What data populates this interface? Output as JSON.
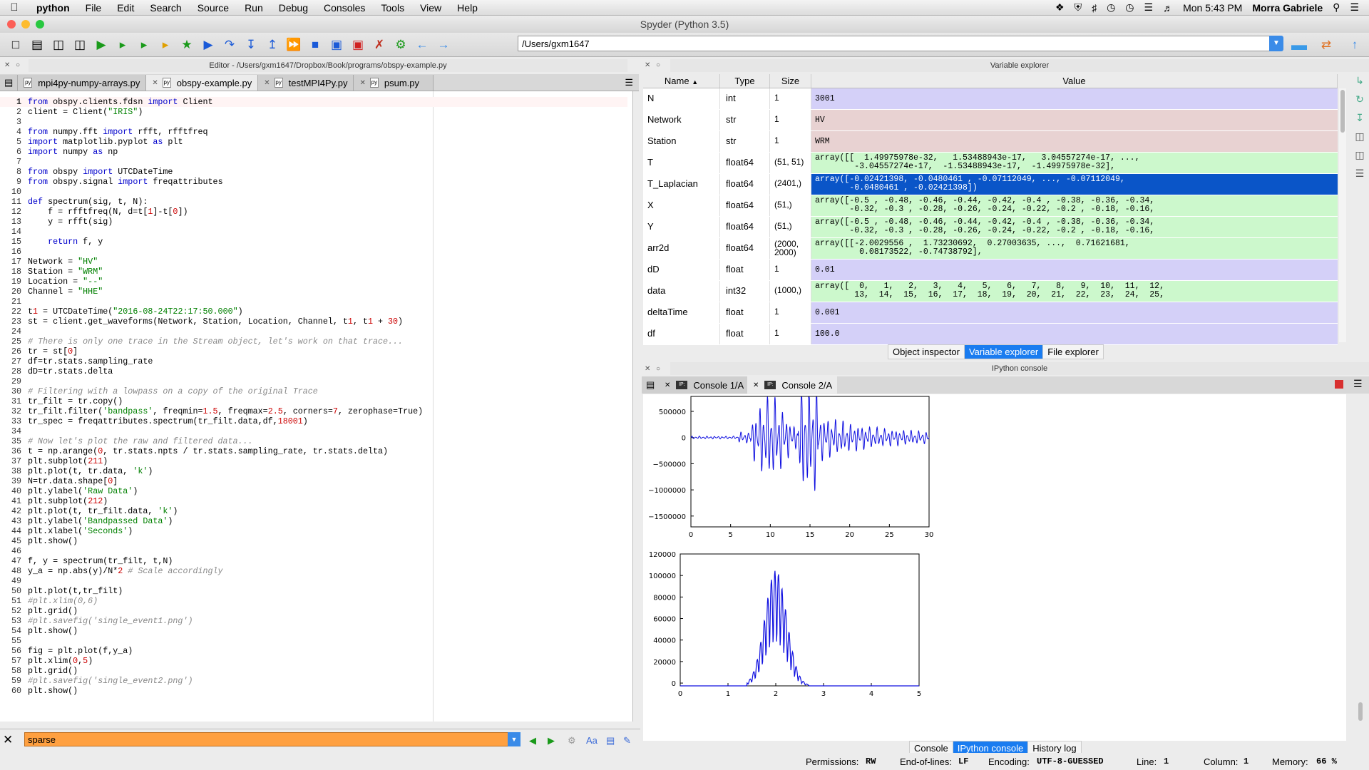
{
  "menubar": {
    "app": "python",
    "items": [
      "File",
      "Edit",
      "Search",
      "Source",
      "Run",
      "Debug",
      "Consoles",
      "Tools",
      "View",
      "Help"
    ],
    "clock": "Mon 5:43 PM",
    "user": "Morra Gabriele"
  },
  "window": {
    "title": "Spyder (Python 3.5)"
  },
  "toolbar": {
    "path": "/Users/gxm1647"
  },
  "editor": {
    "title": "Editor - /Users/gxm1647/Dropbox/Book/programs/obspy-example.py",
    "tabs": [
      "mpi4py-numpy-arrays.py",
      "obspy-example.py",
      "testMPI4Py.py",
      "psum.py"
    ],
    "active_tab": 1,
    "lines": [
      {
        "n": "1",
        "t": "from obspy.clients.fdsn import Client"
      },
      {
        "n": "2",
        "t": "client = Client(\"IRIS\")"
      },
      {
        "n": "3",
        "t": ""
      },
      {
        "n": "4",
        "t": "from numpy.fft import rfft, rfftfreq"
      },
      {
        "n": "5",
        "t": "import matplotlib.pyplot as plt"
      },
      {
        "n": "6",
        "t": "import numpy as np"
      },
      {
        "n": "7",
        "t": ""
      },
      {
        "n": "8",
        "t": "from obspy import UTCDateTime"
      },
      {
        "n": "9",
        "t": "from obspy.signal import freqattributes"
      },
      {
        "n": "10",
        "t": ""
      },
      {
        "n": "11",
        "t": "def spectrum(sig, t, N):"
      },
      {
        "n": "12",
        "t": "    f = rfftfreq(N, d=t[1]-t[0])"
      },
      {
        "n": "13",
        "t": "    y = rfft(sig)"
      },
      {
        "n": "14",
        "t": ""
      },
      {
        "n": "15",
        "t": "    return f, y"
      },
      {
        "n": "16",
        "t": ""
      },
      {
        "n": "17",
        "t": "Network = \"HV\""
      },
      {
        "n": "18",
        "t": "Station = \"WRM\""
      },
      {
        "n": "19",
        "t": "Location = \"--\""
      },
      {
        "n": "20",
        "t": "Channel = \"HHE\""
      },
      {
        "n": "21",
        "t": ""
      },
      {
        "n": "22",
        "t": "t1 = UTCDateTime(\"2016-08-24T22:17:50.000\")"
      },
      {
        "n": "23",
        "t": "st = client.get_waveforms(Network, Station, Location, Channel, t1, t1 + 30)"
      },
      {
        "n": "24",
        "t": ""
      },
      {
        "n": "25",
        "t": "# There is only one trace in the Stream object, let's work on that trace..."
      },
      {
        "n": "26",
        "t": "tr = st[0]"
      },
      {
        "n": "27",
        "t": "df=tr.stats.sampling_rate"
      },
      {
        "n": "28",
        "t": "dD=tr.stats.delta"
      },
      {
        "n": "29",
        "t": ""
      },
      {
        "n": "30",
        "t": "# Filtering with a lowpass on a copy of the original Trace"
      },
      {
        "n": "31",
        "t": "tr_filt = tr.copy()"
      },
      {
        "n": "32",
        "t": "tr_filt.filter('bandpass', freqmin=1.5, freqmax=2.5, corners=7, zerophase=True)"
      },
      {
        "n": "33",
        "t": "tr_spec = freqattributes.spectrum(tr_filt.data,df,18001)"
      },
      {
        "n": "34",
        "t": ""
      },
      {
        "n": "35",
        "t": "# Now let's plot the raw and filtered data..."
      },
      {
        "n": "36",
        "t": "t = np.arange(0, tr.stats.npts / tr.stats.sampling_rate, tr.stats.delta)"
      },
      {
        "n": "37",
        "t": "plt.subplot(211)"
      },
      {
        "n": "38",
        "t": "plt.plot(t, tr.data, 'k')"
      },
      {
        "n": "39",
        "t": "N=tr.data.shape[0]"
      },
      {
        "n": "40",
        "t": "plt.ylabel('Raw Data')"
      },
      {
        "n": "41",
        "t": "plt.subplot(212)"
      },
      {
        "n": "42",
        "t": "plt.plot(t, tr_filt.data, 'k')"
      },
      {
        "n": "43",
        "t": "plt.ylabel('Bandpassed Data')"
      },
      {
        "n": "44",
        "t": "plt.xlabel('Seconds')"
      },
      {
        "n": "45",
        "t": "plt.show()"
      },
      {
        "n": "46",
        "t": ""
      },
      {
        "n": "47",
        "t": "f, y = spectrum(tr_filt, t,N)"
      },
      {
        "n": "48",
        "t": "y_a = np.abs(y)/N*2 # Scale accordingly"
      },
      {
        "n": "49",
        "t": ""
      },
      {
        "n": "50",
        "t": "plt.plot(t,tr_filt)"
      },
      {
        "n": "51",
        "t": "#plt.xlim(0,6)"
      },
      {
        "n": "52",
        "t": "plt.grid()"
      },
      {
        "n": "53",
        "t": "#plt.savefig('single_event1.png')"
      },
      {
        "n": "54",
        "t": "plt.show()"
      },
      {
        "n": "55",
        "t": ""
      },
      {
        "n": "56",
        "t": "fig = plt.plot(f,y_a)"
      },
      {
        "n": "57",
        "t": "plt.xlim(0,5)"
      },
      {
        "n": "58",
        "t": "plt.grid()"
      },
      {
        "n": "59",
        "t": "#plt.savefig('single_event2.png')"
      },
      {
        "n": "60",
        "t": "plt.show()"
      }
    ]
  },
  "find": {
    "value": "sparse"
  },
  "varexp": {
    "title": "Variable explorer",
    "headers": [
      "Name",
      "Type",
      "Size",
      "Value"
    ],
    "rows": [
      {
        "name": "N",
        "type": "int",
        "size": "1",
        "value": "3001",
        "color": "#d4d0f8"
      },
      {
        "name": "Network",
        "type": "str",
        "size": "1",
        "value": "HV",
        "color": "#e8d2d2"
      },
      {
        "name": "Station",
        "type": "str",
        "size": "1",
        "value": "WRM",
        "color": "#e8d2d2"
      },
      {
        "name": "T",
        "type": "float64",
        "size": "(51, 51)",
        "value": "array([[  1.49975978e-32,   1.53488943e-17,   3.04557274e-17, ...,\n        -3.04557274e-17,  -1.53488943e-17,  -1.49975978e-32],",
        "color": "#ccf8cc"
      },
      {
        "name": "T_Laplacian",
        "type": "float64",
        "size": "(2401,)",
        "value": "array([-0.02421398, -0.0480461 , -0.07112049, ..., -0.07112049,\n       -0.0480461 , -0.02421398])",
        "color": "#0a55c8",
        "selected": true
      },
      {
        "name": "X",
        "type": "float64",
        "size": "(51,)",
        "value": "array([-0.5 , -0.48, -0.46, -0.44, -0.42, -0.4 , -0.38, -0.36, -0.34,\n       -0.32, -0.3 , -0.28, -0.26, -0.24, -0.22, -0.2 , -0.18, -0.16,",
        "color": "#ccf8cc"
      },
      {
        "name": "Y",
        "type": "float64",
        "size": "(51,)",
        "value": "array([-0.5 , -0.48, -0.46, -0.44, -0.42, -0.4 , -0.38, -0.36, -0.34,\n       -0.32, -0.3 , -0.28, -0.26, -0.24, -0.22, -0.2 , -0.18, -0.16,",
        "color": "#ccf8cc"
      },
      {
        "name": "arr2d",
        "type": "float64",
        "size": "(2000,\n2000)",
        "value": "array([[-2.0029556 ,  1.73230692,  0.27003635, ...,  0.71621681,\n         0.08173522, -0.74738792],",
        "color": "#ccf8cc"
      },
      {
        "name": "dD",
        "type": "float",
        "size": "1",
        "value": "0.01",
        "color": "#d4d0f8"
      },
      {
        "name": "data",
        "type": "int32",
        "size": "(1000,)",
        "value": "array([  0,   1,   2,   3,   4,   5,   6,   7,   8,   9,  10,  11,  12,\n        13,  14,  15,  16,  17,  18,  19,  20,  21,  22,  23,  24,  25,",
        "color": "#ccf8cc"
      },
      {
        "name": "deltaTime",
        "type": "float",
        "size": "1",
        "value": "0.001",
        "color": "#d4d0f8"
      },
      {
        "name": "df",
        "type": "float",
        "size": "1",
        "value": "100.0",
        "color": "#d4d0f8"
      }
    ],
    "bottom_tabs": [
      "Object inspector",
      "Variable explorer",
      "File explorer"
    ],
    "active_bottom": 1
  },
  "ipython": {
    "title": "IPython console",
    "tabs": [
      "Console 1/A",
      "Console 2/A"
    ],
    "active_tab": 1,
    "bottom_tabs": [
      "Console",
      "IPython console",
      "History log"
    ],
    "active_bottom": 1
  },
  "plot1": {
    "yticks": [
      "500000",
      "0",
      "−500000",
      "−1000000",
      "−1500000"
    ],
    "xticks": [
      "0",
      "5",
      "10",
      "15",
      "20",
      "25",
      "30"
    ]
  },
  "plot2": {
    "yticks": [
      "120000",
      "100000",
      "80000",
      "60000",
      "40000",
      "20000",
      "0"
    ],
    "xticks": [
      "0",
      "1",
      "2",
      "3",
      "4",
      "5"
    ]
  },
  "status": {
    "permissions_label": "Permissions:",
    "permissions": "RW",
    "eol_label": "End-of-lines:",
    "eol": "LF",
    "encoding_label": "Encoding:",
    "encoding": "UTF-8-GUESSED",
    "line_label": "Line:",
    "line": "1",
    "column_label": "Column:",
    "column": "1",
    "memory_label": "Memory:",
    "memory": "66 %"
  }
}
